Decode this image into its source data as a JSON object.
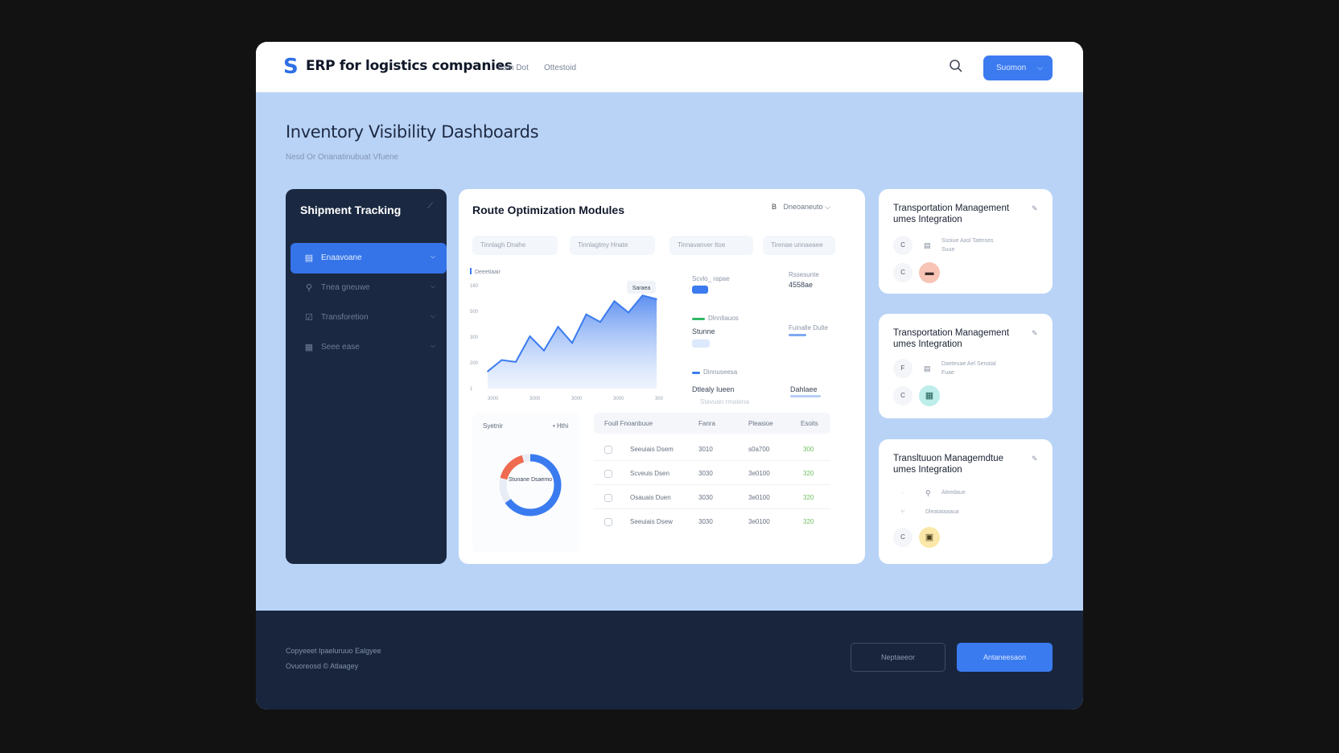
{
  "header": {
    "logo": "S",
    "title": "ERP for logistics companies",
    "nav": [
      "Sam Dot",
      "Ottestoid"
    ],
    "cta_label": "Suomon"
  },
  "page": {
    "title": "Inventory Visibility Dashboards",
    "subtitle": "Nesd Or Onanatinubuat Vfuene"
  },
  "sidebar": {
    "title": "Shipment Tracking",
    "items": [
      {
        "label": "Enaavoane",
        "icon": "inventory-icon",
        "active": true
      },
      {
        "label": "Tnea gneuwe",
        "icon": "route-icon",
        "active": false
      },
      {
        "label": "Transforetion",
        "icon": "check-icon",
        "active": false
      },
      {
        "label": "Seee ease",
        "icon": "report-icon",
        "active": false
      }
    ]
  },
  "route": {
    "title": "Route Optimization Modules",
    "menu_icon": "B",
    "menu_label": "Dneoaneuto",
    "pills": [
      "Tinnlagh Dnahe",
      "Tinnlagtmy Hnate",
      "Tinnavanver Itoe",
      "Tirenae unnaeaee"
    ],
    "chart_label": "Deeetiaair",
    "chart_tag": "Saraea",
    "metrics": {
      "m1_label": "Scvlo_ rapae",
      "m1_value": "4558ae",
      "m1_sub": "Rssesunte",
      "m2_label": "Dlnnltauos",
      "m2_value": "Stunne",
      "m2_sub": "Fuinalle Dulte",
      "m3_label": "Dinnuseesa",
      "m3_value": "Dtlealy Iueen",
      "m3_sub": "Stavuan rmatena",
      "m3_right": "Dahlaee"
    },
    "donut": {
      "head": "Syetnir",
      "head2": "• Hthi",
      "center": "Stunane Dsaemo"
    },
    "table": {
      "headers": [
        "Foull Fnoanbuue",
        "Fanra",
        "Pleasioe",
        "Esoits"
      ],
      "rows": [
        [
          "Seeuiais Dsem",
          "3010",
          "s0a700",
          "300"
        ],
        [
          "Scveuis Dsen",
          "3030",
          "3e0100",
          "320"
        ],
        [
          "Osauais Duen",
          "3030",
          "3e0100",
          "320"
        ],
        [
          "Seeuiais Dsew",
          "3030",
          "3e0100",
          "320"
        ]
      ]
    }
  },
  "tm_cards": [
    {
      "title": "Transportation Management umes Integration",
      "chip1": "C",
      "chip2": "C",
      "text1": "Ssoiue Aasl Tattnses",
      "text2": "Suue",
      "badge_icon": "truck-icon",
      "badge_glyph": "▬"
    },
    {
      "title": "Transportation Management umes Integration",
      "chip1": "F",
      "chip2": "C",
      "text1": "Daeteuae Ael Senatal",
      "text2": "Fuae",
      "badge_icon": "grid-icon",
      "badge_glyph": "▦"
    },
    {
      "title": "Transltuuon Managemdtue umes Integration",
      "chip1": "",
      "chip2": "C",
      "text1": "Aleedaue",
      "text2": "Dleatataaaua",
      "badge_icon": "box-icon",
      "badge_glyph": "▣"
    }
  ],
  "footer": {
    "line1": "Copyeeet Ipaeluruuo Ealgyee",
    "line2": "Ovuoreosd © Atlaagey",
    "secondary_label": "Neptaeeor",
    "primary_label": "Antaneesaon"
  },
  "chart_data": {
    "type": "area",
    "title": "",
    "ylabel": "",
    "xlabel": "",
    "y_ticks": [
      "160",
      "500",
      "300",
      "200",
      "1"
    ],
    "x_ticks": [
      "3000",
      "3000",
      "3000",
      "3000",
      "3000"
    ],
    "x": [
      0,
      1,
      2,
      3,
      4,
      5,
      6,
      7,
      8,
      9,
      10,
      11,
      12
    ],
    "values": [
      18,
      30,
      28,
      55,
      40,
      65,
      48,
      78,
      70,
      92,
      80,
      98,
      94
    ],
    "ylim": [
      0,
      110
    ],
    "color": "#3b7bef"
  },
  "colors": {
    "accent": "#3b7bef",
    "sidebar_bg": "#1a2841",
    "donut_blue": "#3a7bf0",
    "donut_red": "#ef6a4f",
    "badge_red": "#f7c4b6",
    "badge_teal": "#bdeee9",
    "badge_yellow": "#fbe7a8"
  }
}
